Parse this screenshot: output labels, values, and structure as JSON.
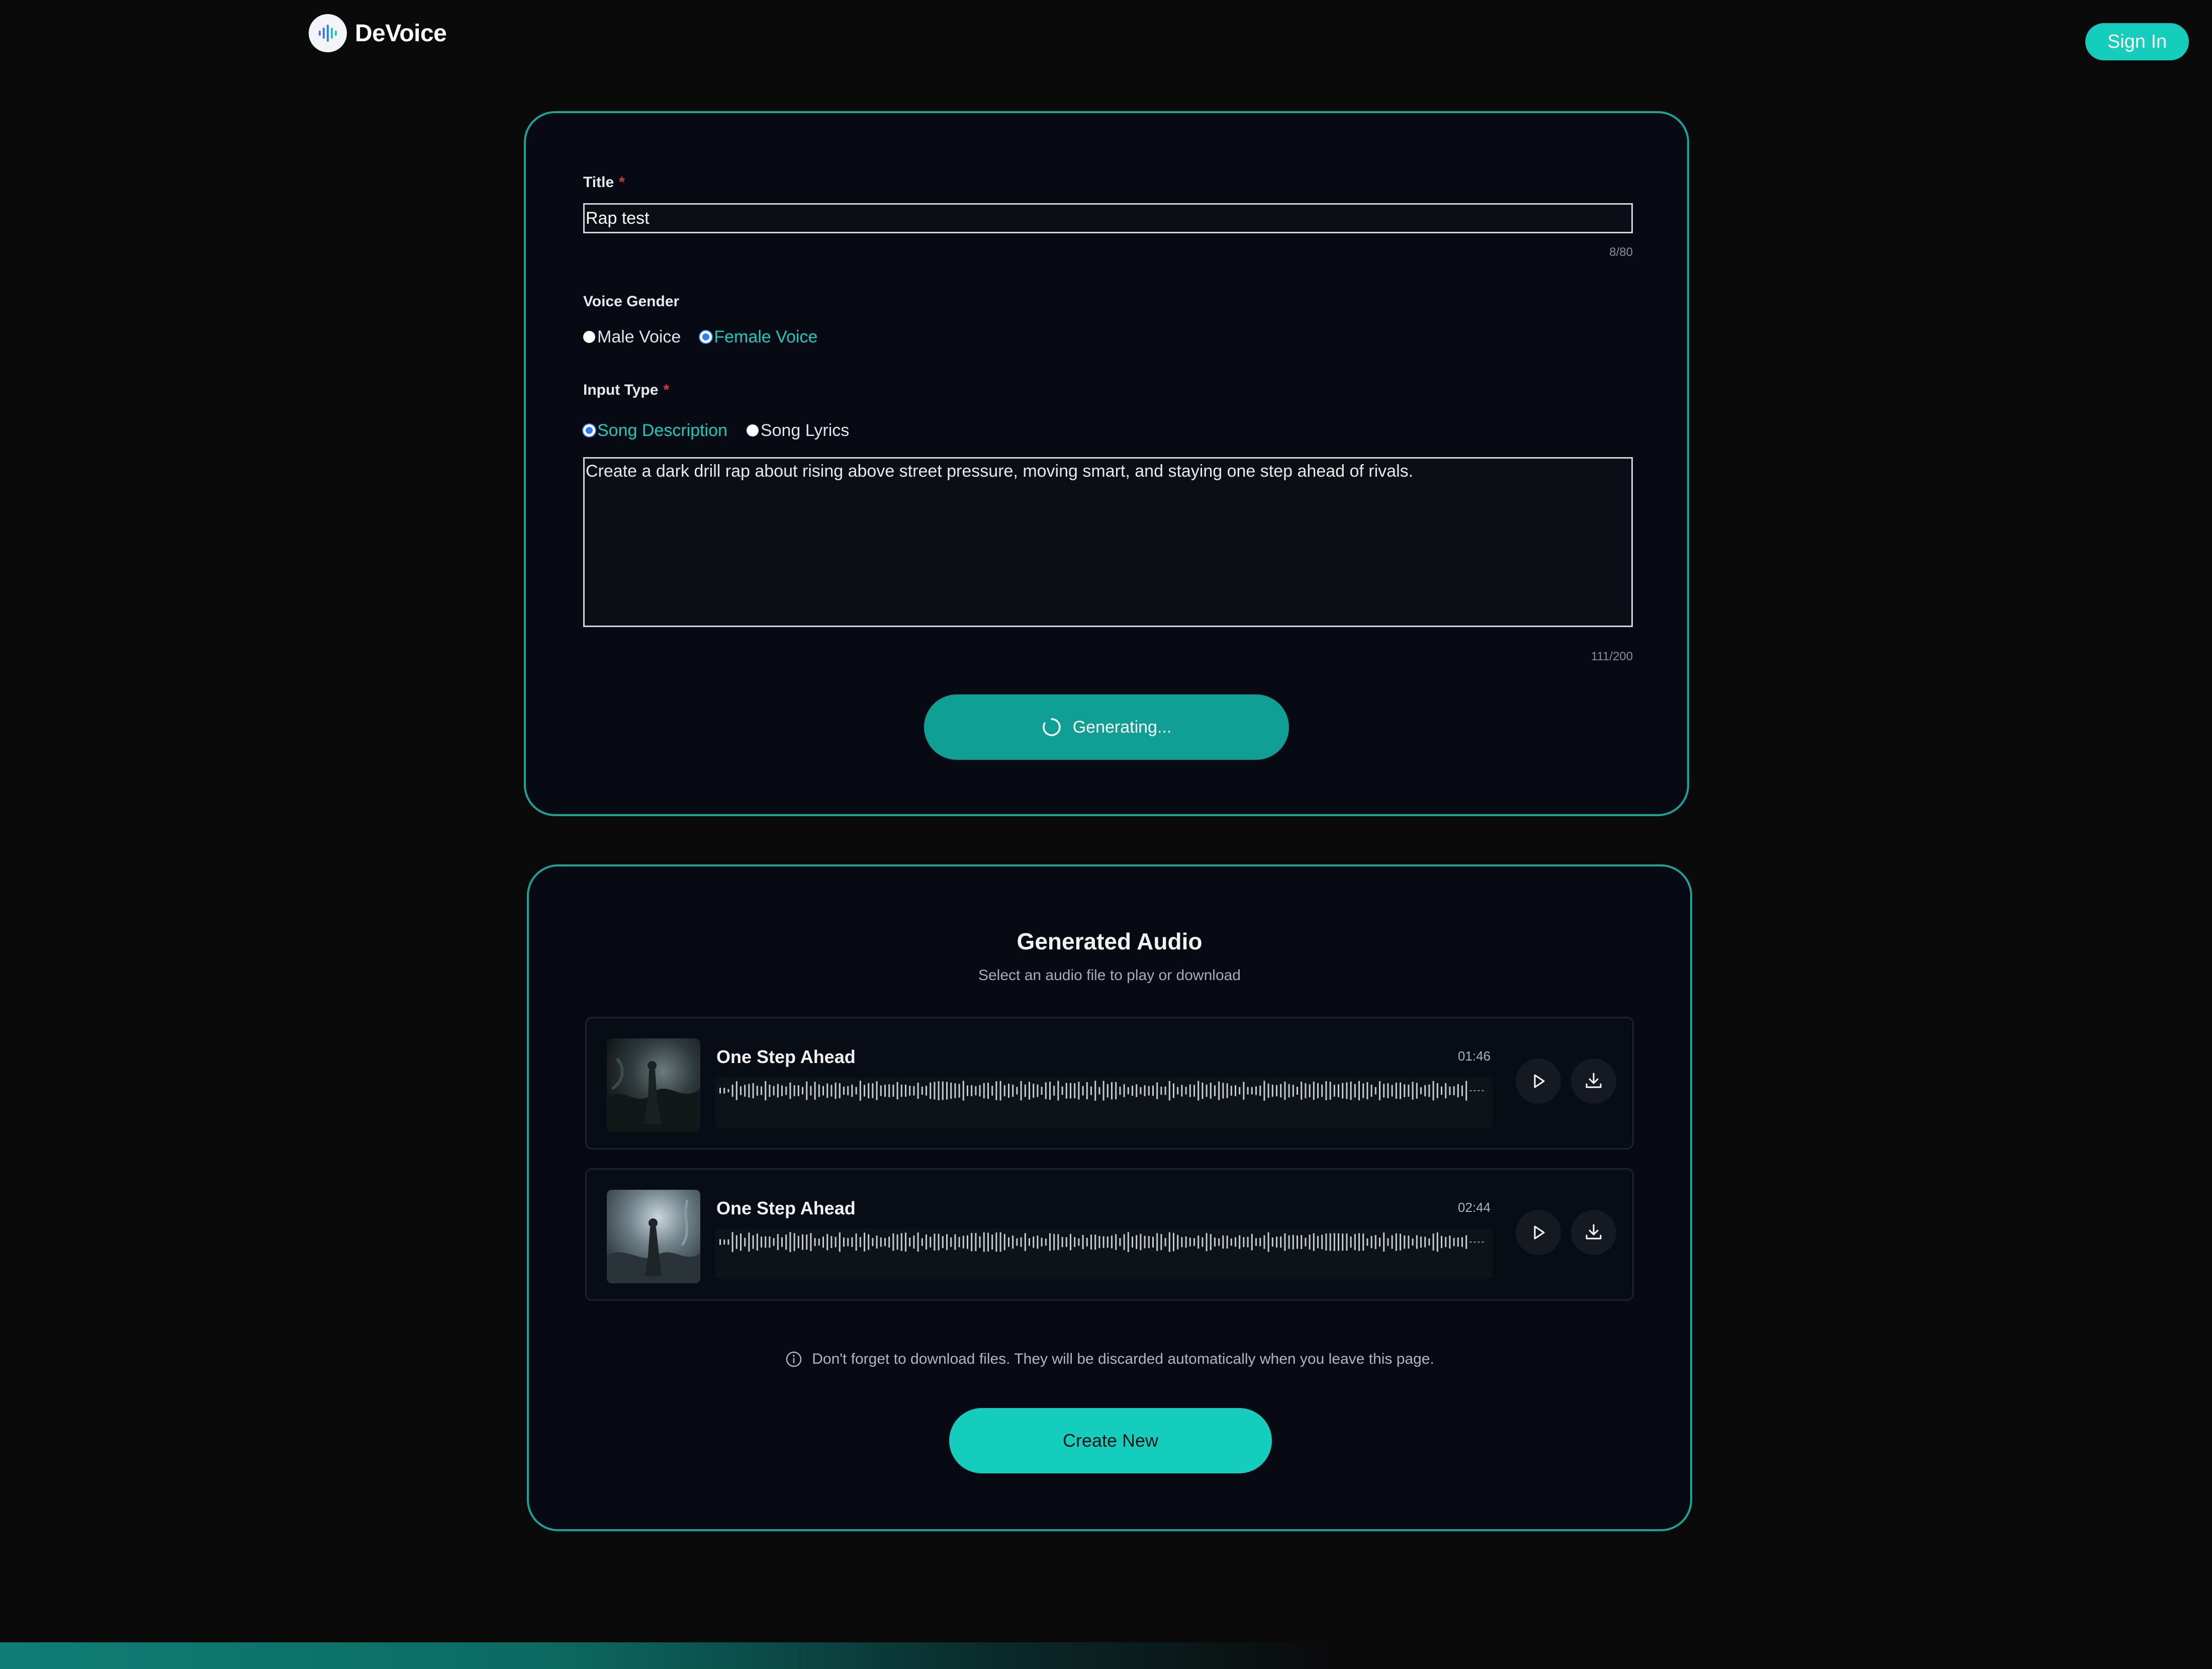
{
  "app": {
    "name": "DeVoice"
  },
  "header": {
    "sign_in_label": "Sign In"
  },
  "form": {
    "title_label": "Title",
    "required_mark": "*",
    "title_value": "Rap test",
    "title_counter": "8/80",
    "voice_gender_label": "Voice Gender",
    "voice_options": [
      {
        "label": "Male Voice",
        "selected": false
      },
      {
        "label": "Female Voice",
        "selected": true
      }
    ],
    "input_type_label": "Input Type",
    "input_type_options": [
      {
        "label": "Song Description",
        "selected": true
      },
      {
        "label": "Song Lyrics",
        "selected": false
      }
    ],
    "description_value": "Create a dark drill rap about rising above street pressure, moving smart, and staying one step ahead of rivals.",
    "description_counter": "111/200",
    "generate_label": "Generating..."
  },
  "audio": {
    "title": "Generated Audio",
    "subtitle": "Select an audio file to play or download",
    "tracks": [
      {
        "name": "One Step Ahead",
        "duration": "01:46"
      },
      {
        "name": "One Step Ahead",
        "duration": "02:44"
      }
    ],
    "note": "Don't forget to download files. They will be discarded automatically when you leave this page.",
    "create_new_label": "Create New"
  },
  "colors": {
    "accent": "#14cdbd",
    "accent_dark": "#109f94",
    "card_border": "#16a596",
    "background": "#0a0a0b",
    "required": "#d63a3a",
    "radio_selected": "#2f7cf6"
  },
  "icons": {
    "logo": "sound-wave-icon",
    "spinner": "loading-spinner-icon",
    "play": "play-icon",
    "download": "download-icon",
    "info": "info-circle-icon"
  }
}
